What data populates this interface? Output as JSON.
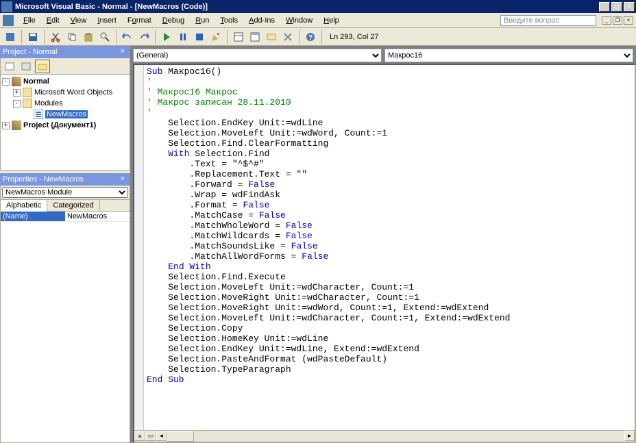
{
  "title": "Microsoft Visual Basic - Normal - [NewMacros (Code)]",
  "menus": {
    "file": "File",
    "edit": "Edit",
    "view": "View",
    "insert": "Insert",
    "format": "Format",
    "debug": "Debug",
    "run": "Run",
    "tools": "Tools",
    "addins": "Add-Ins",
    "window": "Window",
    "help": "Help"
  },
  "askbox": "Введите вопрос",
  "statusline": "Ln 293, Col 27",
  "project_panel": {
    "title": "Project - Normal",
    "tree": {
      "normal": {
        "label": "Normal",
        "expanded": true
      },
      "mwo": {
        "label": "Microsoft Word Objects",
        "expanded": false
      },
      "modules": {
        "label": "Modules",
        "expanded": true
      },
      "newmacros": {
        "label": "NewMacros"
      },
      "proj2": {
        "label": "Project (Документ1)",
        "expanded": false
      }
    }
  },
  "properties_panel": {
    "title": "Properties - NewMacros",
    "combo_label": "NewMacros Module",
    "tabs": {
      "alpha": "Alphabetic",
      "cat": "Categorized"
    },
    "rows": [
      {
        "k": "(Name)",
        "v": "NewMacros"
      }
    ]
  },
  "code_combos": {
    "left": "(General)",
    "right": "Макрос16"
  },
  "code_tokens": [
    [
      {
        "t": "Sub ",
        "c": "kw"
      },
      {
        "t": "Макрос16()"
      }
    ],
    [
      {
        "t": "'",
        "c": "cm"
      }
    ],
    [
      {
        "t": "' Макрос16 Макрос",
        "c": "cm"
      }
    ],
    [
      {
        "t": "' Макрос записан 28.11.2010",
        "c": "cm"
      }
    ],
    [
      {
        "t": "'",
        "c": "cm"
      }
    ],
    [
      {
        "t": "    Selection.EndKey Unit:=wdLine"
      }
    ],
    [
      {
        "t": "    Selection.MoveLeft Unit:=wdWord, Count:=1"
      }
    ],
    [
      {
        "t": "    Selection.Find.ClearFormatting"
      }
    ],
    [
      {
        "t": "    ",
        "c": ""
      },
      {
        "t": "With ",
        "c": "kw"
      },
      {
        "t": "Selection.Find"
      }
    ],
    [
      {
        "t": "        .Text = \"^$^#\""
      }
    ],
    [
      {
        "t": "        .Replacement.Text = \"\""
      }
    ],
    [
      {
        "t": "        .Forward = "
      },
      {
        "t": "False",
        "c": "kw"
      }
    ],
    [
      {
        "t": "        .Wrap = wdFindAsk"
      }
    ],
    [
      {
        "t": "        .Format = "
      },
      {
        "t": "False",
        "c": "kw"
      }
    ],
    [
      {
        "t": "        .MatchCase = "
      },
      {
        "t": "False",
        "c": "kw"
      }
    ],
    [
      {
        "t": "        .MatchWholeWord = "
      },
      {
        "t": "False",
        "c": "kw"
      }
    ],
    [
      {
        "t": "        .MatchWildcards = "
      },
      {
        "t": "False",
        "c": "kw"
      }
    ],
    [
      {
        "t": "        .MatchSoundsLike = "
      },
      {
        "t": "False",
        "c": "kw"
      }
    ],
    [
      {
        "t": "        .MatchAllWordForms = "
      },
      {
        "t": "False",
        "c": "kw"
      }
    ],
    [
      {
        "t": "    ",
        "c": ""
      },
      {
        "t": "End With",
        "c": "kw"
      }
    ],
    [
      {
        "t": "    Selection.Find.Execute"
      }
    ],
    [
      {
        "t": "    Selection.MoveLeft Unit:=wdCharacter, Count:=1"
      }
    ],
    [
      {
        "t": "    Selection.MoveRight Unit:=wdCharacter, Count:=1"
      }
    ],
    [
      {
        "t": "    Selection.MoveRight Unit:=wdWord, Count:=1, Extend:=wdExtend"
      }
    ],
    [
      {
        "t": "    Selection.MoveLeft Unit:=wdCharacter, Count:=1, Extend:=wdExtend"
      }
    ],
    [
      {
        "t": "    Selection.Copy"
      }
    ],
    [
      {
        "t": "    Selection.HomeKey Unit:=wdLine"
      }
    ],
    [
      {
        "t": "    Selection.EndKey Unit:=wdLine, Extend:=wdExtend"
      }
    ],
    [
      {
        "t": "    Selection.PasteAndFormat (wdPasteDefault)"
      }
    ],
    [
      {
        "t": "    Selection.TypeParagraph"
      }
    ],
    [
      {
        "t": "End Sub",
        "c": "kw"
      }
    ]
  ]
}
